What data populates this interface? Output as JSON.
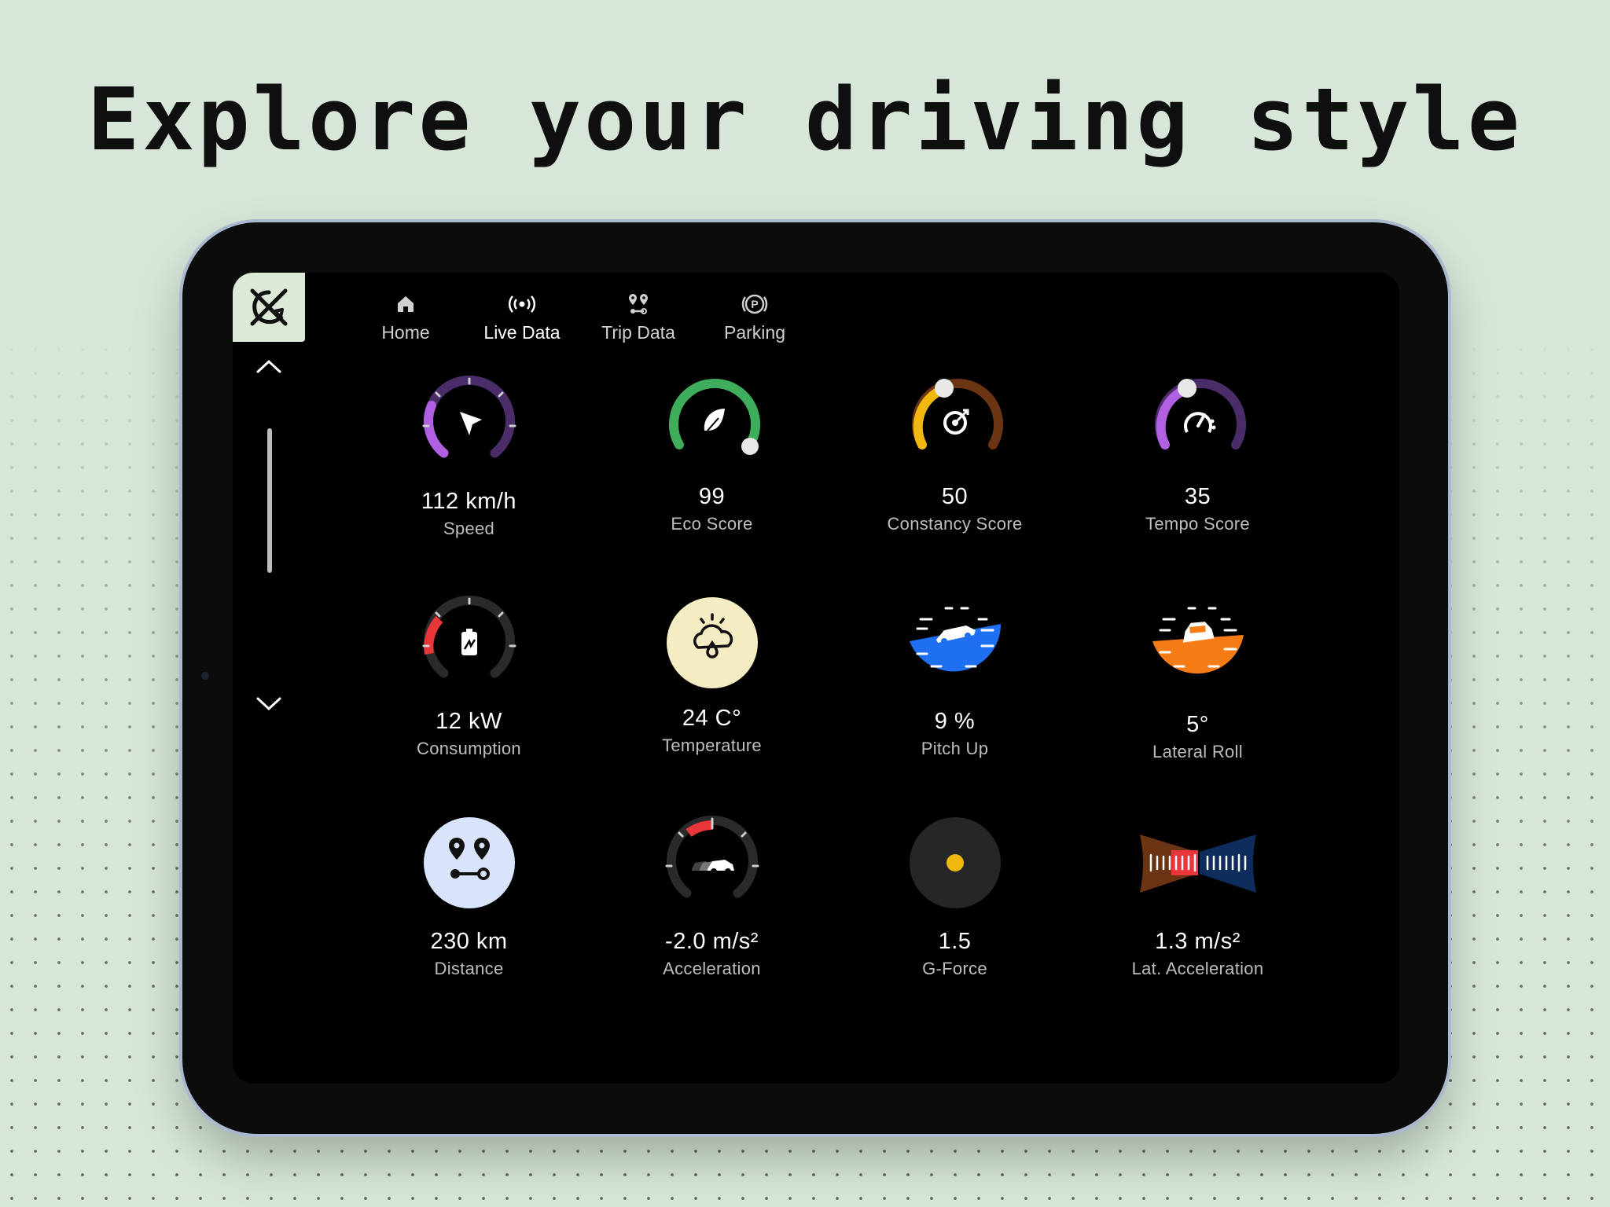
{
  "headline": "Explore your driving style",
  "nav": {
    "tabs": [
      {
        "label": "Home",
        "icon": "home-icon"
      },
      {
        "label": "Live Data",
        "icon": "broadcast-icon",
        "active": true
      },
      {
        "label": "Trip Data",
        "icon": "route-icon"
      },
      {
        "label": "Parking",
        "icon": "parking-icon"
      }
    ]
  },
  "widgets": [
    {
      "value": "112 km/h",
      "label": "Speed",
      "icon": "navigation-arrow-icon",
      "color": "#b060e0",
      "track": "#4a2d68"
    },
    {
      "value": "99",
      "label": "Eco Score",
      "icon": "leaf-icon",
      "color": "#3fae5c"
    },
    {
      "value": "50",
      "label": "Constancy Score",
      "icon": "target-icon",
      "color": "#f1b90f",
      "track": "#6b3412"
    },
    {
      "value": "35",
      "label": "Tempo Score",
      "icon": "speedometer-icon",
      "color": "#b060e0",
      "track": "#4a2d68"
    },
    {
      "value": "12 kW",
      "label": "Consumption",
      "icon": "battery-icon",
      "color": "#e8363b",
      "track": "#2a2a2a"
    },
    {
      "value": "24 C°",
      "label": "Temperature",
      "icon": "weather-icon",
      "color": "#f4ecc2"
    },
    {
      "value": "9 %",
      "label": "Pitch Up",
      "icon": "car-pitch-icon",
      "color": "#1f6ff2"
    },
    {
      "value": "5°",
      "label": "Lateral Roll",
      "icon": "car-roll-icon",
      "color": "#f57c14"
    },
    {
      "value": "230 km",
      "label": "Distance",
      "icon": "route-pin-icon",
      "color": "#d7e4fb"
    },
    {
      "value": "-2.0 m/s²",
      "label": "Acceleration",
      "icon": "car-motion-icon",
      "color": "#e8363b",
      "track": "#2a2a2a"
    },
    {
      "value": "1.5",
      "label": "G-Force",
      "icon": "g-force-dot-icon",
      "color": "#f1b90f",
      "track": "#262626"
    },
    {
      "value": "1.3 m/s²",
      "label": "Lat. Acceleration",
      "icon": "lateral-bar-icon",
      "color": "#e8363b"
    }
  ]
}
